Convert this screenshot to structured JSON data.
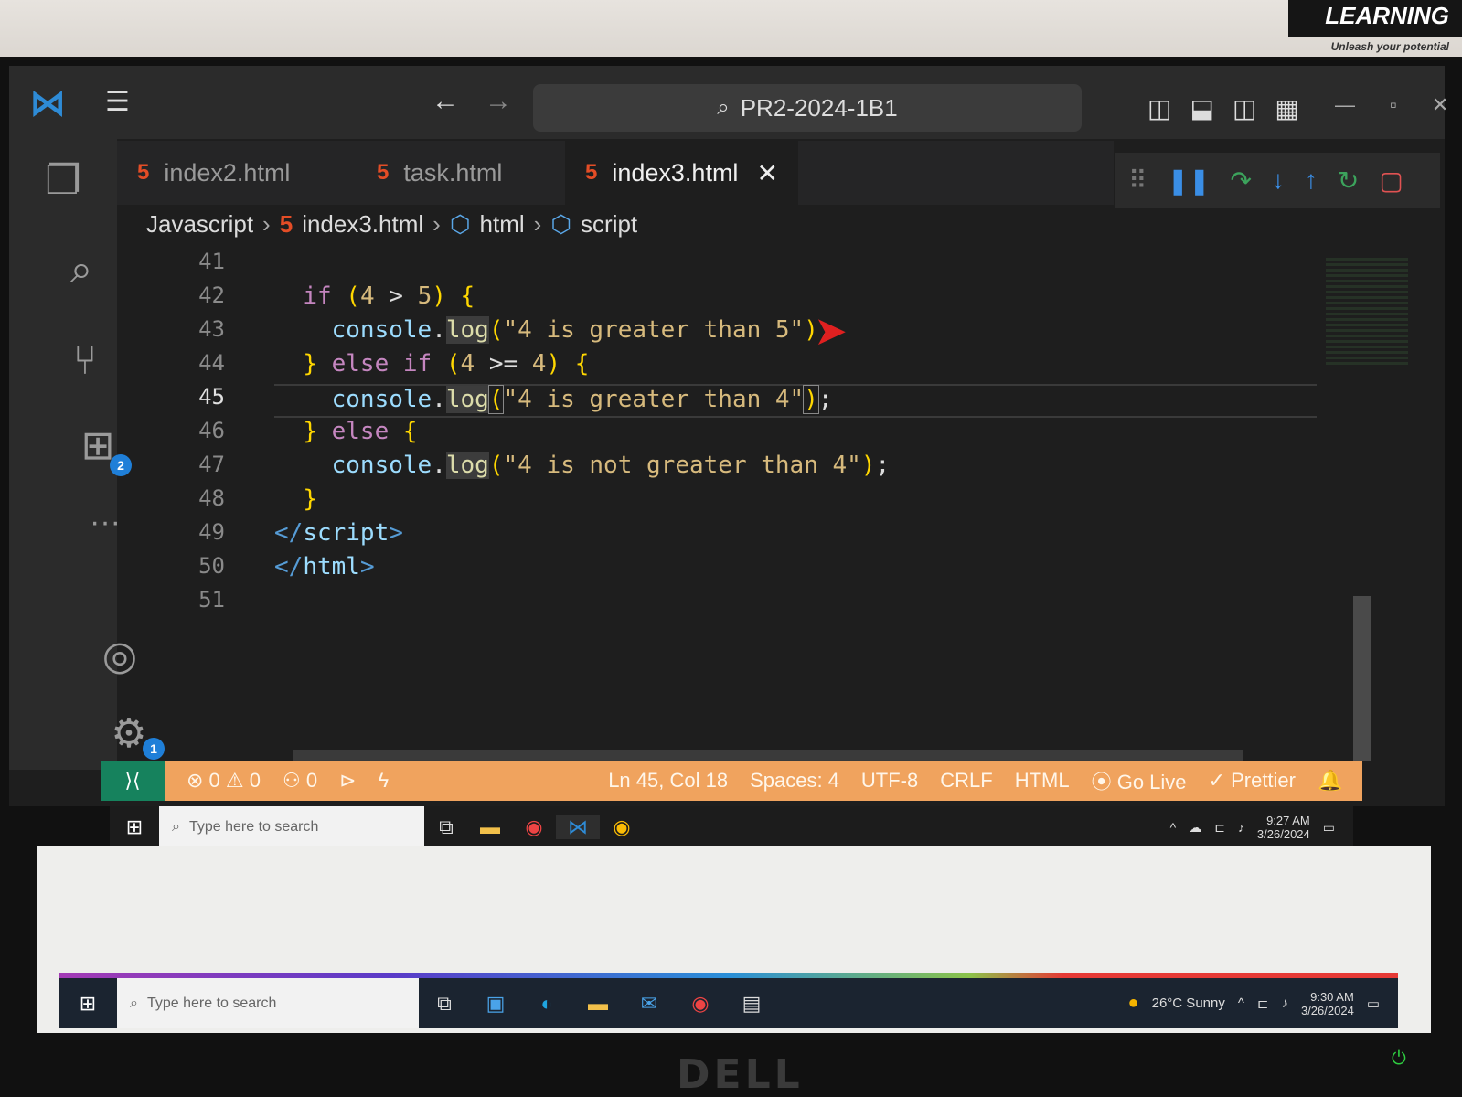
{
  "brand": {
    "title": "LEARNING",
    "subtitle": "Unleash your potential"
  },
  "window": {
    "command_center": "PR2-2024-1B1"
  },
  "tabs": [
    {
      "label": "index2.html"
    },
    {
      "label": "task.html"
    },
    {
      "label": "index3.html",
      "active": true
    }
  ],
  "breadcrumb": [
    "Javascript",
    "index3.html",
    "html",
    "script"
  ],
  "activity_badges": {
    "extensions": "2",
    "settings": "1"
  },
  "editor": {
    "line_numbers": [
      "41",
      "42",
      "43",
      "44",
      "45",
      "46",
      "47",
      "48",
      "49",
      "50",
      "51"
    ],
    "current_line": "45"
  },
  "statusbar": {
    "errors": "0",
    "warnings": "0",
    "ports": "0",
    "position": "Ln 45, Col 18",
    "spaces": "Spaces: 4",
    "encoding": "UTF-8",
    "eol": "CRLF",
    "language": "HTML",
    "golive": "Go Live",
    "prettier": "Prettier"
  },
  "inner_taskbar": {
    "search_placeholder": "Type here to search",
    "time": "9:27 AM",
    "date": "3/26/2024"
  },
  "outer_taskbar": {
    "search_placeholder": "Type here to search",
    "weather": "26°C  Sunny",
    "time": "9:30 AM",
    "date": "3/26/2024"
  },
  "monitor_brand": "DELL",
  "colors": {
    "statusbar": "#f0a35e",
    "remote": "#16825d",
    "accent": "#1f7fd8"
  }
}
